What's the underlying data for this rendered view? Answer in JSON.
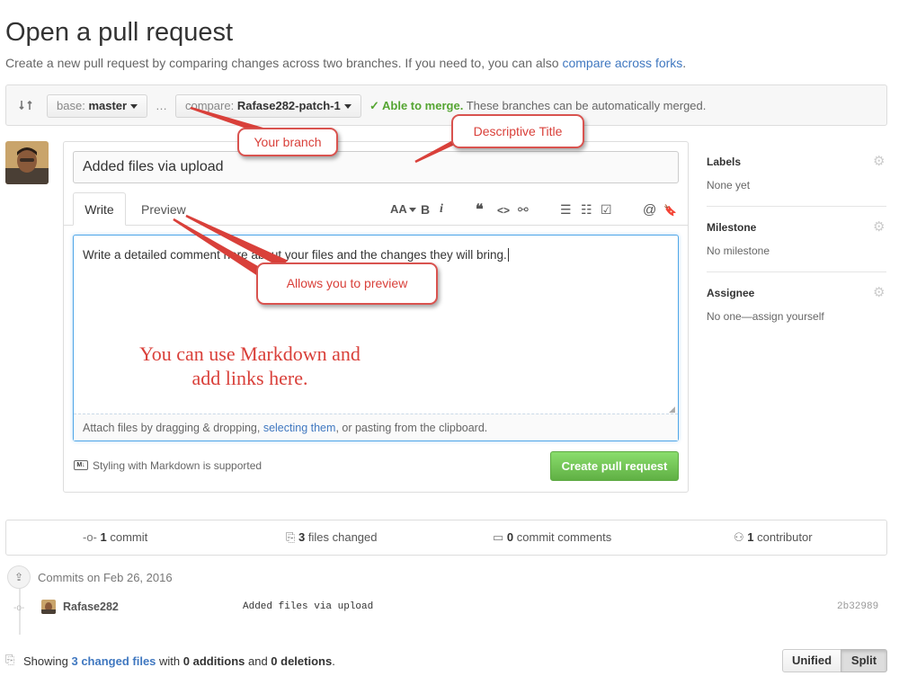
{
  "page": {
    "title": "Open a pull request",
    "subtitle": "Create a new pull request by comparing changes across two branches. If you need to, you can also ",
    "subtitle_link": "compare across forks",
    "subtitle_end": "."
  },
  "range": {
    "base_prefix": "base:",
    "base_branch": "master",
    "ellipsis": "…",
    "compare_prefix": "compare:",
    "compare_branch": "Rafase282-patch-1",
    "merge_status": "✓ Able to merge.",
    "merge_note": "These branches can be automatically merged."
  },
  "form": {
    "title_value": "Added files via upload",
    "tabs": [
      "Write",
      "Preview"
    ],
    "comment_value": "Write a detailed comment here about your files and the changes they will bring.",
    "attach_prefix": "Attach files by dragging & dropping, ",
    "attach_link": "selecting them",
    "attach_suffix": ", or pasting from the clipboard.",
    "markdown_note": "Styling with Markdown is supported",
    "markdown_icon": "M↓",
    "create_button": "Create pull request"
  },
  "toolbar": {
    "header": "AA",
    "bold": "B",
    "italic": "i",
    "quote": "❝",
    "code": "<>",
    "link": "⚯",
    "unordered_list": "☰",
    "ordered_list": "☷",
    "task_list": "☑",
    "mention": "@",
    "bookmark": "🔖"
  },
  "sidebar": {
    "labels_title": "Labels",
    "labels_value": "None yet",
    "milestone_title": "Milestone",
    "milestone_value": "No milestone",
    "assignee_title": "Assignee",
    "assignee_value": "No one—assign yourself"
  },
  "stats": {
    "commits_count": "1",
    "commits_label": " commit",
    "files_count": "3",
    "files_label": " files changed",
    "comments_count": "0",
    "comments_label": " commit comments",
    "contributors_count": "1",
    "contributors_label": " contributor"
  },
  "commits": {
    "date_header": "Commits on Feb 26, 2016",
    "items": [
      {
        "author": "Rafase282",
        "message": "Added files via upload",
        "sha": "2b32989"
      }
    ]
  },
  "diff": {
    "showing": "Showing ",
    "changed_files": "3 changed files",
    "with": " with ",
    "additions": "0 additions",
    "and": " and ",
    "deletions": "0 deletions",
    "period": ".",
    "unified": "Unified",
    "split": "Split"
  },
  "annotations": {
    "your_branch": "Your branch",
    "descriptive_title": "Descriptive Title",
    "allows_preview": "Allows you to preview",
    "markdown_line1": "You can use Markdown and",
    "markdown_line2": "add links here."
  },
  "colors": {
    "link": "#4078c0",
    "merge_green": "#55a532",
    "create_green": "#60b044",
    "callout_red": "#d9403a"
  }
}
